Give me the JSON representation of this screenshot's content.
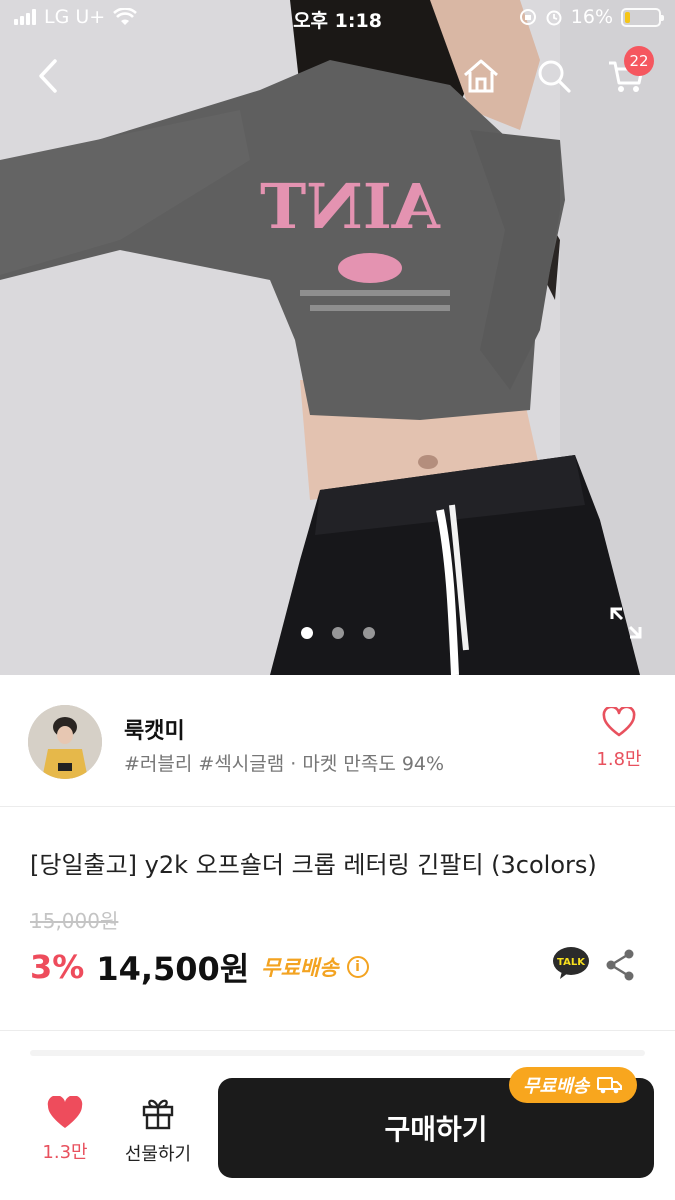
{
  "status_bar": {
    "carrier": "LG U+",
    "time": "오후 1:18",
    "battery_percent": "16%",
    "battery_level": 0.16
  },
  "nav": {
    "cart_count": "22",
    "icons": [
      "back-icon",
      "home-icon",
      "search-icon",
      "cart-icon"
    ]
  },
  "gallery": {
    "page_count": 3,
    "active_page": 1,
    "expand_icon": "expand-icon"
  },
  "shop": {
    "name": "룩캣미",
    "tags": "#러블리 #섹시글램 · 마켓 만족도 94%",
    "like_count": "1.8만"
  },
  "product": {
    "title": "[당일출고] y2k 오프숄더 크롭 레터링 긴팔티 (3colors)",
    "original_price": "15,000원",
    "discount": "3%",
    "price": "14,500원",
    "shipping": "무료배송",
    "talk_label": "TALK"
  },
  "bottom": {
    "wish_count": "1.3만",
    "gift_label": "선물하기",
    "buy_label": "구매하기",
    "shipping_badge": "무료배송"
  },
  "colors": {
    "accent_red": "#ee4c5c",
    "free_shipping": "#f3a321",
    "buy_button": "#1b1b1b"
  }
}
